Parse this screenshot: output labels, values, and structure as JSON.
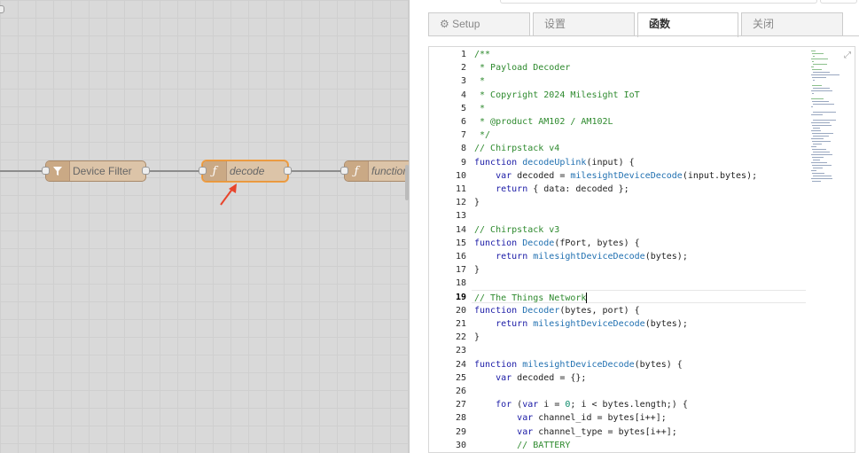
{
  "canvas": {
    "nodes": [
      {
        "name": "node-device-filter",
        "label": "Device Filter",
        "icon": "filter-icon"
      },
      {
        "name": "node-decode",
        "label": "decode",
        "icon": "function-icon"
      },
      {
        "name": "node-function",
        "label": "function",
        "icon": "function-icon"
      }
    ]
  },
  "panel": {
    "tabs": [
      {
        "label": "⚙ Setup",
        "active": false
      },
      {
        "label": "设置",
        "active": false
      },
      {
        "label": "函数",
        "active": true
      },
      {
        "label": "关闭",
        "active": false
      }
    ],
    "editor": {
      "current_line": 19,
      "line_numbers": [
        "1",
        "2",
        "3",
        "4",
        "5",
        "6",
        "7",
        "8",
        "9",
        "10",
        "11",
        "12",
        "13",
        "14",
        "15",
        "16",
        "17",
        "18",
        "19",
        "20",
        "21",
        "22",
        "23",
        "24",
        "25",
        "26",
        "27",
        "28",
        "29",
        "30"
      ],
      "lines": [
        "/**",
        " * Payload Decoder",
        " *",
        " * Copyright 2024 Milesight IoT",
        " *",
        " * @product AM102 / AM102L",
        " */",
        "// Chirpstack v4",
        "function decodeUplink(input) {",
        "    var decoded = milesightDeviceDecode(input.bytes);",
        "    return { data: decoded };",
        "}",
        "",
        "// Chirpstack v3",
        "function Decode(fPort, bytes) {",
        "    return milesightDeviceDecode(bytes);",
        "}",
        "",
        "// The Things Network",
        "function Decoder(bytes, port) {",
        "    return milesightDeviceDecode(bytes);",
        "}",
        "",
        "function milesightDeviceDecode(bytes) {",
        "    var decoded = {};",
        "",
        "    for (var i = 0; i < bytes.length;) {",
        "        var channel_id = bytes[i++];",
        "        var channel_type = bytes[i++];",
        "        // BATTERY"
      ]
    }
  }
}
